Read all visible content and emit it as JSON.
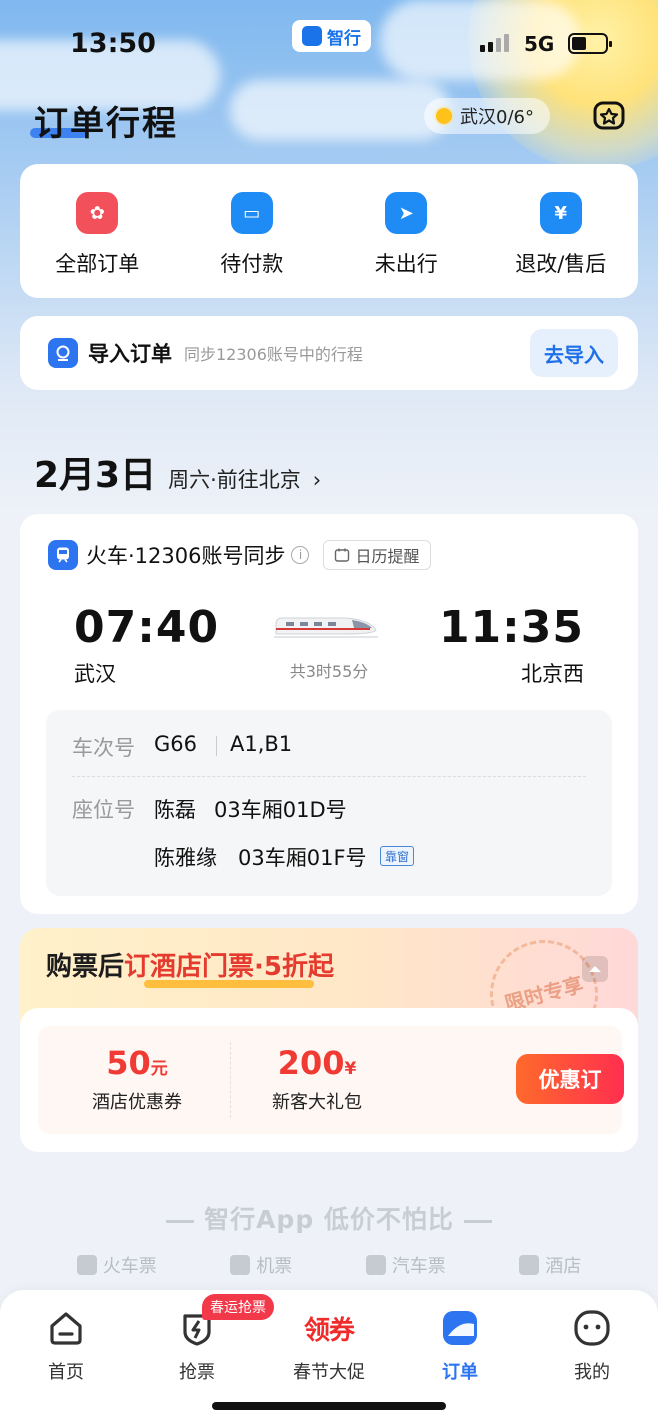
{
  "status_bar": {
    "time": "13:50",
    "network": "5G",
    "app_pill": "智行"
  },
  "header": {
    "title": "订单行程",
    "weather": "武汉0/6°"
  },
  "menu": [
    {
      "label": "全部订单",
      "color": "#f2505a"
    },
    {
      "label": "待付款",
      "color": "#1f8bf5"
    },
    {
      "label": "未出行",
      "color": "#1f8bf5"
    },
    {
      "label": "退改/售后",
      "color": "#1f8bf5"
    }
  ],
  "import_bar": {
    "title": "导入订单",
    "subtitle": "同步12306账号中的行程",
    "button": "去导入"
  },
  "trip_date": {
    "date": "2月3日",
    "sub": "周六·前往北京",
    "chevron": "›"
  },
  "trip": {
    "type_label": "火车·12306账号同步",
    "calendar_reminder": "日历提醒",
    "depart_time": "07:40",
    "depart_city": "武汉",
    "arrive_time": "11:35",
    "arrive_city": "北京西",
    "duration": "共3时55分",
    "train_no_label": "车次号",
    "train_no": "G66",
    "gate": "A1,B1",
    "seat_label": "座位号",
    "passengers": [
      {
        "name": "陈磊",
        "seat": "03车厢01D号"
      },
      {
        "name": "陈雅缘",
        "seat": "03车厢01F号",
        "tag": "靠窗"
      }
    ]
  },
  "promo": {
    "title_1": "购票后",
    "title_2": "订酒店门票",
    "title_3": "·",
    "title_4": "5折起",
    "stamp": "限时专享",
    "coupon_1_amount": "50",
    "coupon_1_unit": "元",
    "coupon_1_label": "酒店优惠券",
    "coupon_2_amount": "200",
    "coupon_2_unit": "¥",
    "coupon_2_label": "新客大礼包",
    "button": "优惠订"
  },
  "slogan": "智行App 低价不怕比",
  "quick_links": [
    "火车票",
    "机票",
    "汽车票",
    "酒店"
  ],
  "tabs": [
    {
      "label": "首页"
    },
    {
      "label": "抢票",
      "badge": "春运抢票"
    },
    {
      "label": "春节大促",
      "icon_text": "领券"
    },
    {
      "label": "订单",
      "active": true
    },
    {
      "label": "我的"
    }
  ],
  "colors": {
    "accent": "#2d74f0",
    "promo_red": "#ef3b33"
  }
}
